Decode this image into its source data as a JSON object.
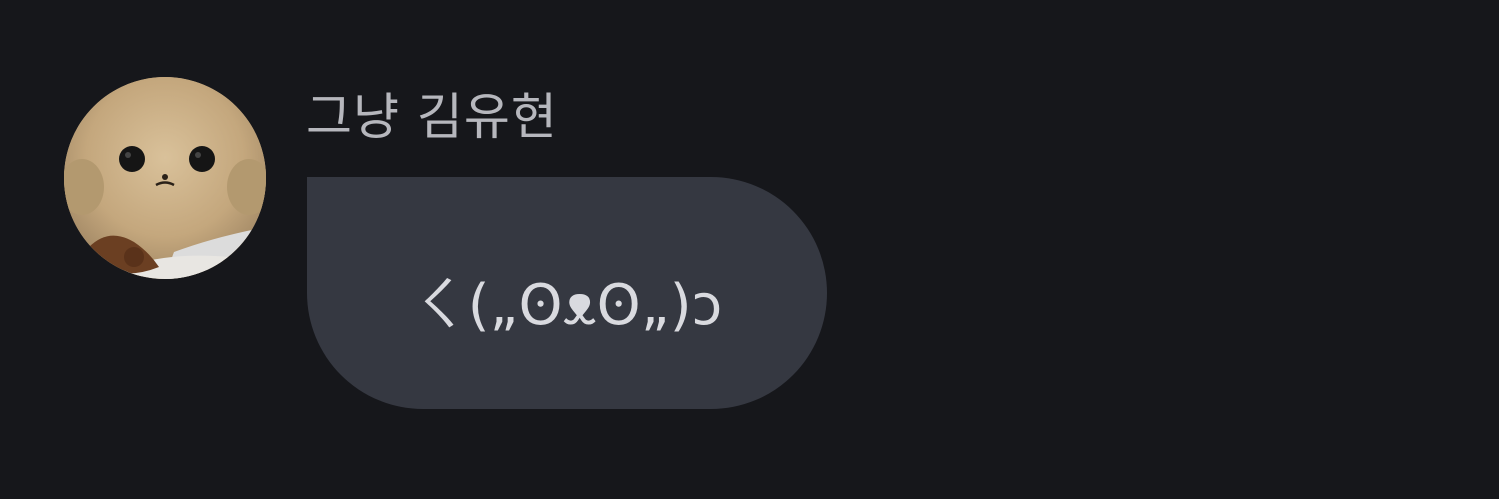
{
  "message": {
    "sender_name": "그냥 김유현",
    "text": "ㄑ(„ʘᴥʘ„)ɔ",
    "avatar_icon": "plush-toy-avatar"
  },
  "colors": {
    "background": "#16171b",
    "bubble": "#353841",
    "sender_name": "#b6b7bd",
    "message_text": "#d9dadf"
  }
}
